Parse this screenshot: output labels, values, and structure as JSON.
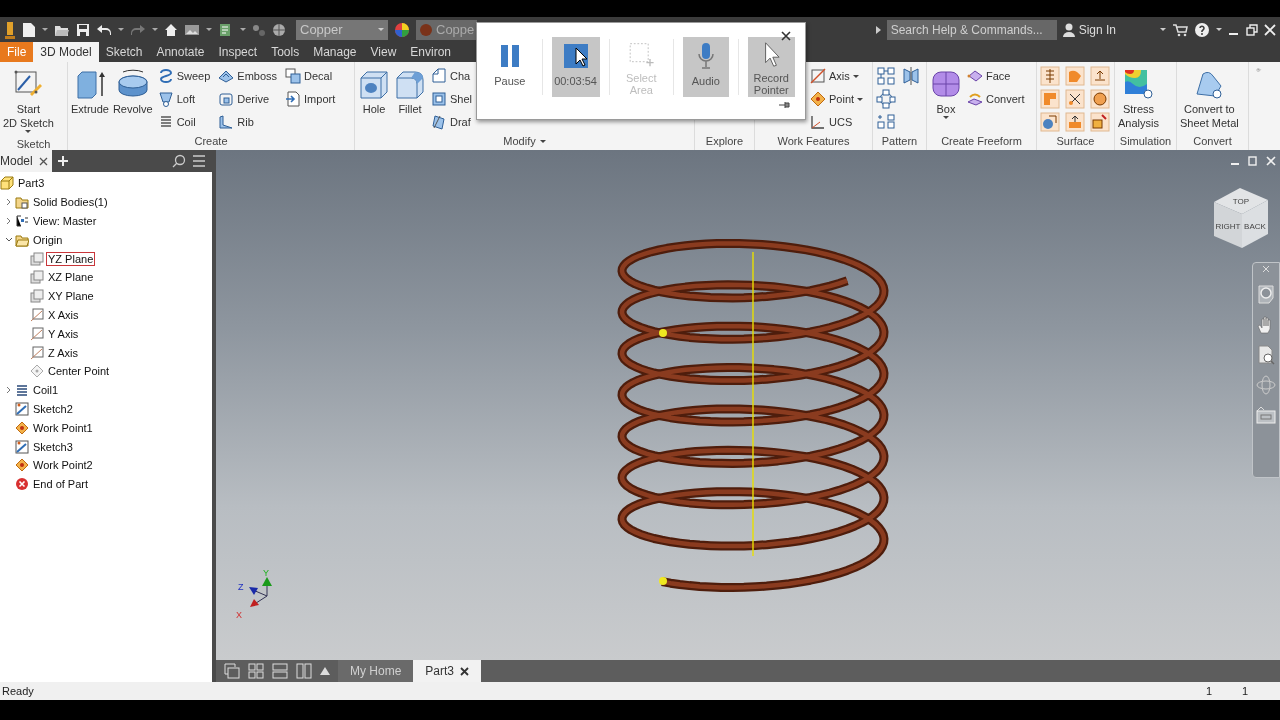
{
  "quick_access": {
    "material": "Copper",
    "appearance": "Coppe",
    "search": {
      "placeholder": "Search Help & Commands..."
    },
    "user": "Sign In"
  },
  "ribbon_tabs": [
    {
      "label": "File",
      "kind": "menu",
      "selected": false
    },
    {
      "label": "3D Model",
      "kind": "tab",
      "selected": true
    },
    {
      "label": "Sketch",
      "kind": "tab",
      "selected": false
    },
    {
      "label": "Annotate",
      "kind": "tab",
      "selected": false
    },
    {
      "label": "Inspect",
      "kind": "tab",
      "selected": false
    },
    {
      "label": "Tools",
      "kind": "tab",
      "selected": false
    },
    {
      "label": "Manage",
      "kind": "tab",
      "selected": false
    },
    {
      "label": "View",
      "kind": "tab",
      "selected": false
    },
    {
      "label": "Environ",
      "kind": "tab",
      "selected": false
    }
  ],
  "ribbon": {
    "panels": [
      {
        "title": "Sketch",
        "kind": "tools",
        "title_dropdown": false,
        "tools": [
          {
            "label": "Start\n2D Sketch",
            "kind": "large",
            "dropdown": true
          }
        ]
      },
      {
        "title": "Create",
        "kind": "tools",
        "title_dropdown": false,
        "tools": [
          {
            "label": "Extrude",
            "kind": "large",
            "dropdown": false
          },
          {
            "label": "Revolve",
            "kind": "large",
            "dropdown": false
          },
          {
            "label": "Sweep",
            "kind": "small",
            "dropdown": false
          },
          {
            "label": "Loft",
            "kind": "small",
            "dropdown": false
          },
          {
            "label": "Coil",
            "kind": "small",
            "dropdown": false
          },
          {
            "label": "Emboss",
            "kind": "small",
            "dropdown": false
          },
          {
            "label": "Derive",
            "kind": "small",
            "dropdown": false
          },
          {
            "label": "Rib",
            "kind": "small",
            "dropdown": false
          },
          {
            "label": "Decal",
            "kind": "small",
            "dropdown": false
          },
          {
            "label": "Import",
            "kind": "small",
            "dropdown": false
          }
        ]
      },
      {
        "title": "Modify",
        "kind": "tools",
        "title_dropdown": true,
        "tools": [
          {
            "label": "Hole",
            "kind": "large",
            "dropdown": false
          },
          {
            "label": "Fillet",
            "kind": "large",
            "dropdown": false
          },
          {
            "label": "Cha",
            "kind": "small",
            "dropdown": false
          },
          {
            "label": "Shel",
            "kind": "small",
            "dropdown": false
          },
          {
            "label": "Draf",
            "kind": "small",
            "dropdown": false
          }
        ]
      },
      {
        "title": "Explore",
        "kind": "tools",
        "title_dropdown": false
      },
      {
        "title": "Work Features",
        "kind": "tools",
        "title_dropdown": false,
        "tools": [
          {
            "label": "Axis",
            "kind": "small",
            "dropdown": true
          },
          {
            "label": "Point",
            "kind": "small",
            "dropdown": true
          },
          {
            "label": "UCS",
            "kind": "small",
            "dropdown": false
          }
        ]
      },
      {
        "title": "Pattern",
        "kind": "pattern",
        "title_dropdown": false
      },
      {
        "title": "Create Freeform",
        "kind": "tools",
        "title_dropdown": false,
        "tools": [
          {
            "label": "Box",
            "kind": "large",
            "dropdown": true
          },
          {
            "label": "Face",
            "kind": "small",
            "dropdown": false
          },
          {
            "label": "Convert",
            "kind": "small",
            "dropdown": false
          }
        ]
      },
      {
        "title": "Surface",
        "kind": "surface",
        "title_dropdown": false
      },
      {
        "title": "Simulation",
        "kind": "tools",
        "title_dropdown": false,
        "tools": [
          {
            "label": "Stress\nAnalysis",
            "kind": "large",
            "dropdown": false
          }
        ]
      },
      {
        "title": "Convert",
        "kind": "tools",
        "title_dropdown": false,
        "tools": [
          {
            "label": "Convert to\nSheet Metal",
            "kind": "large",
            "dropdown": false
          }
        ]
      }
    ]
  },
  "recorder": {
    "buttons": [
      {
        "label": "Pause",
        "kind": "pause",
        "on": false,
        "disabled": false
      },
      {
        "label": "00:03:54",
        "kind": "stop",
        "on": true,
        "disabled": false
      },
      {
        "label": "Select\nArea",
        "kind": "area",
        "on": false,
        "disabled": true
      },
      {
        "label": "Audio",
        "kind": "audio",
        "on": true,
        "disabled": false
      },
      {
        "label": "Record\nPointer",
        "kind": "pointer",
        "on": true,
        "disabled": false
      }
    ]
  },
  "browser": {
    "tab": "Model",
    "tree": [
      {
        "label": "Part3",
        "kind": "part",
        "selected": false,
        "children": [
          {
            "label": "Solid Bodies(1)",
            "kind": "bodies",
            "selected": false,
            "expanded": false
          },
          {
            "label": "View: Master",
            "kind": "view",
            "selected": false,
            "expanded": false
          },
          {
            "label": "Origin",
            "kind": "folder",
            "selected": false,
            "expanded": true,
            "children": [
              {
                "label": "YZ Plane",
                "kind": "plane",
                "selected": true
              },
              {
                "label": "XZ Plane",
                "kind": "plane",
                "selected": false
              },
              {
                "label": "XY Plane",
                "kind": "plane",
                "selected": false
              },
              {
                "label": "X Axis",
                "kind": "axis",
                "selected": false
              },
              {
                "label": "Y Axis",
                "kind": "axis",
                "selected": false
              },
              {
                "label": "Z Axis",
                "kind": "axis",
                "selected": false
              },
              {
                "label": "Center Point",
                "kind": "point",
                "selected": false
              }
            ]
          },
          {
            "label": "Coil1",
            "kind": "coil",
            "selected": false,
            "expanded": false
          },
          {
            "label": "Sketch2",
            "kind": "sketch",
            "selected": false
          },
          {
            "label": "Work Point1",
            "kind": "workpoint",
            "selected": false
          },
          {
            "label": "Sketch3",
            "kind": "sketch",
            "selected": false
          },
          {
            "label": "Work Point2",
            "kind": "workpoint",
            "selected": false
          },
          {
            "label": "End of Part",
            "kind": "end",
            "selected": false
          }
        ]
      }
    ]
  },
  "viewport": {
    "view_cube": [
      "TOP",
      "RIGHT",
      "BACK"
    ],
    "axes": [
      "X",
      "Y",
      "Z"
    ]
  },
  "document_tabs": [
    {
      "label": "My Home",
      "selected": false,
      "closable": false
    },
    {
      "label": "Part3",
      "selected": true,
      "closable": true
    }
  ],
  "status_bar": {
    "message": "Ready",
    "values": [
      "1",
      "1"
    ]
  }
}
